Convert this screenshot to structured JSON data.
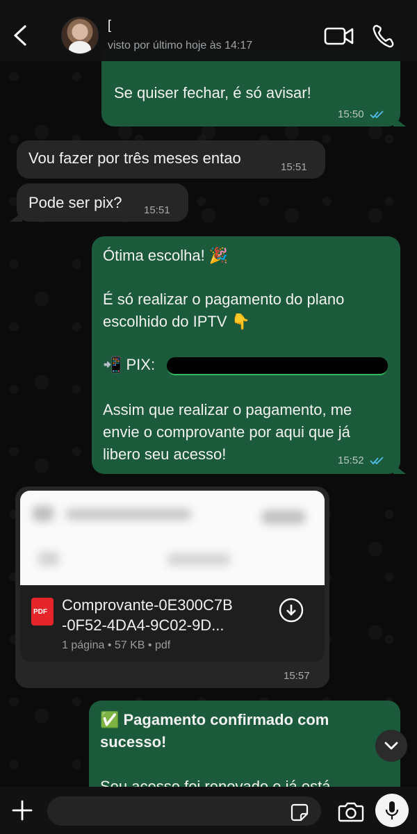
{
  "header": {
    "contact_name": "[",
    "last_seen": "visto por último hoje às 14:17"
  },
  "messages": [
    {
      "direction": "out",
      "text": "Se quiser fechar, é só avisar!",
      "time": "15:50",
      "status": "read"
    },
    {
      "direction": "in",
      "text": "Vou fazer por três meses entao",
      "time": "15:51"
    },
    {
      "direction": "in",
      "text": "Pode ser pix?",
      "time": "15:51"
    },
    {
      "direction": "out",
      "lines": [
        "Ótima escolha! 🎉",
        "É só realizar o pagamento do plano",
        "escolhido do IPTV  👇",
        "📲 PIX:",
        "Assim que realizar o pagamento, me",
        "envie o comprovante por aqui que já",
        "libero seu acesso!"
      ],
      "time": "15:52",
      "status": "read"
    },
    {
      "direction": "in",
      "type": "document",
      "file_name_line1": "Comprovante-0E300C7B",
      "file_name_line2": "-0F52-4DA4-9C02-9D...",
      "file_meta": "1 página • 57 KB • pdf",
      "file_badge": "PDF",
      "time": "15:57"
    },
    {
      "direction": "out",
      "bold_lines": [
        "✅ Pagamento confirmado com",
        "sucesso!"
      ],
      "partial_line": "Seu acesso foi renovado e já está"
    }
  ],
  "icons": {
    "back": "chevron-left-icon",
    "video": "video-camera-icon",
    "phone": "phone-icon",
    "plus": "plus-icon",
    "sticker": "sticker-icon",
    "camera": "camera-icon",
    "mic": "microphone-icon",
    "scroll": "chevron-down-icon",
    "ticks": "double-check-icon",
    "download": "download-icon"
  },
  "colors": {
    "outgoing_bubble": "#1b5a3b",
    "incoming_bubble": "#262626",
    "read_ticks": "#53bdeb",
    "background": "#0b0b0b"
  }
}
